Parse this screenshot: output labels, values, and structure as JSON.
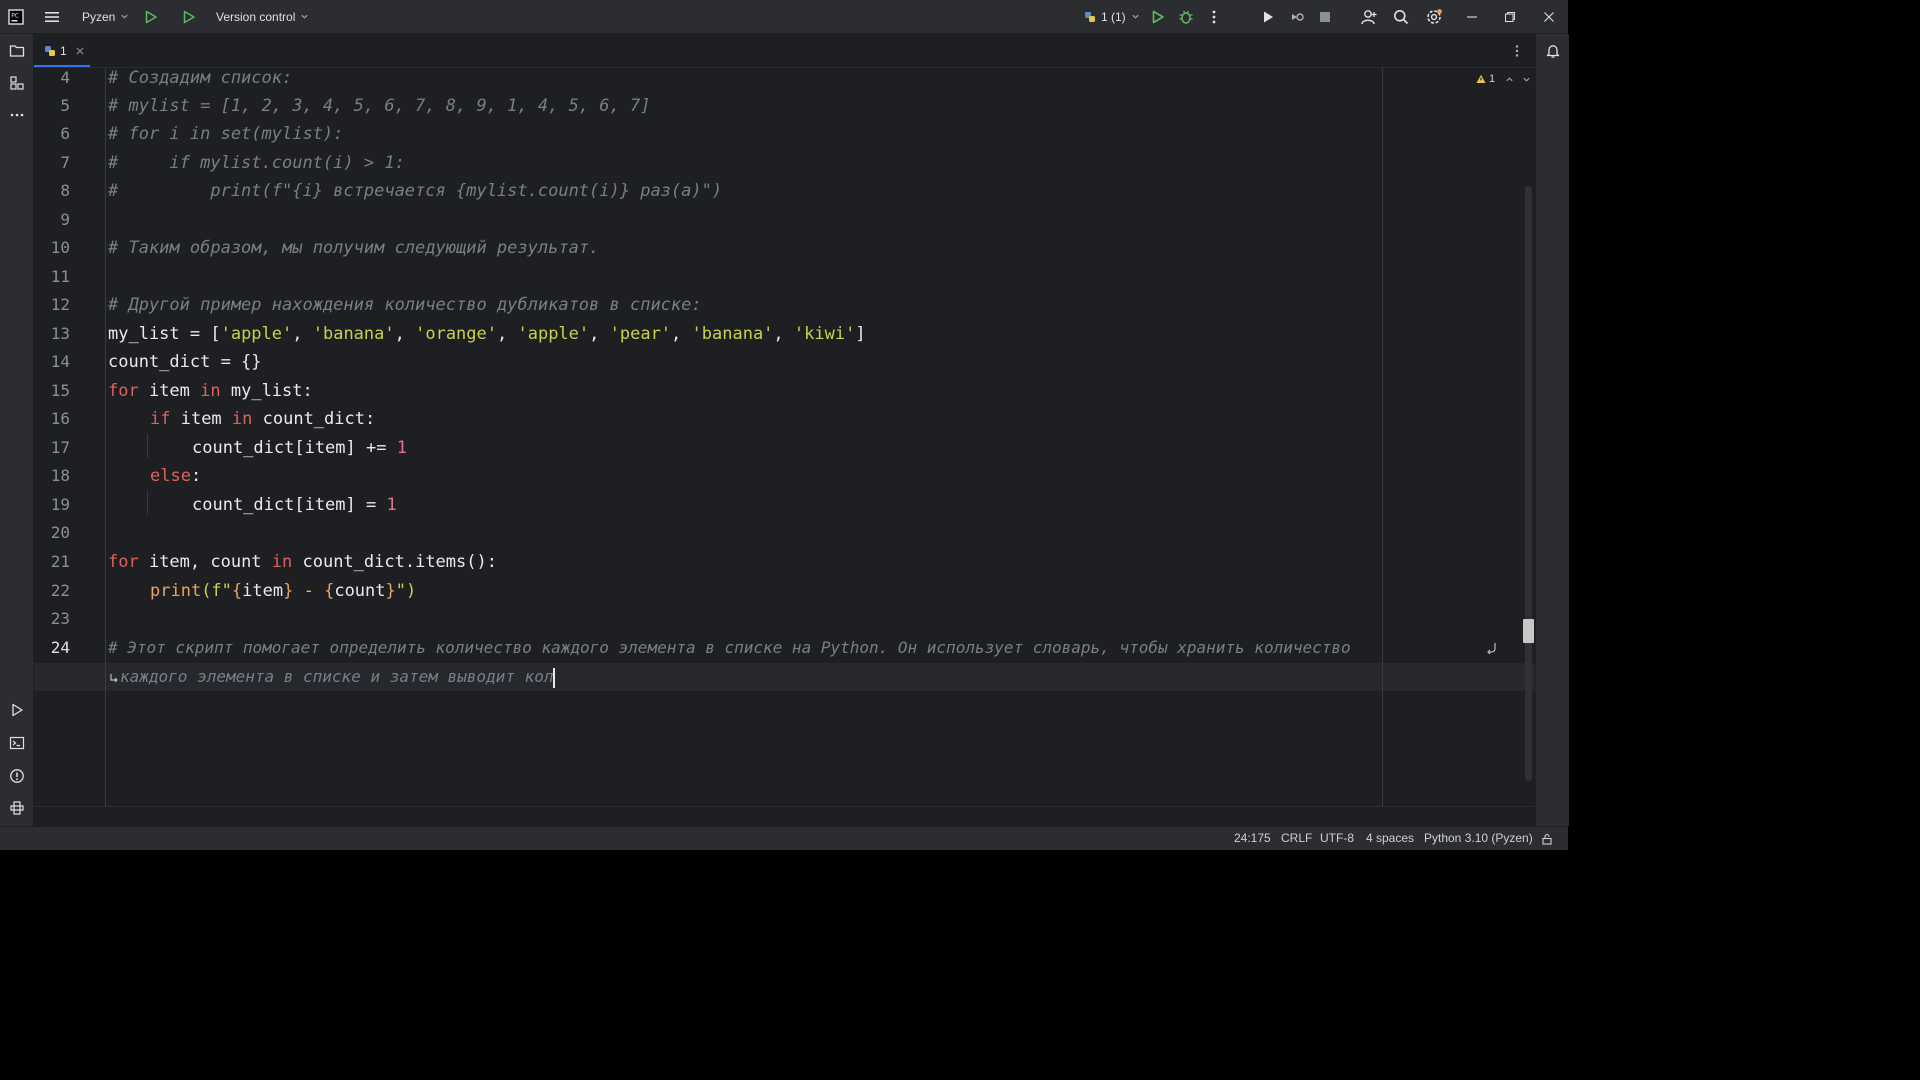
{
  "titlebar": {
    "project": "Pyzen",
    "vcs": "Version control",
    "run_config": "1 (1)"
  },
  "tabs": [
    {
      "label": "1"
    }
  ],
  "inspection": {
    "warnings": "1"
  },
  "editor": {
    "line_numbers": [
      "4",
      "5",
      "6",
      "7",
      "8",
      "9",
      "10",
      "11",
      "12",
      "13",
      "14",
      "15",
      "16",
      "17",
      "18",
      "19",
      "20",
      "21",
      "22",
      "23",
      "24"
    ],
    "lines": {
      "l4": "# Создадим список:",
      "l5": "# mylist = [1, 2, 3, 4, 5, 6, 7, 8, 9, 1, 4, 5, 6, 7]",
      "l6": "# for i in set(mylist):",
      "l7": "#     if mylist.count(i) > 1:",
      "l8": "#         print(f\"{i} встречается {mylist.count(i)} раз(а)\")",
      "l10": "# Таким образом, мы получим следующий результат.",
      "l12": "# Другой пример нахождения количество дубликатов в списке:",
      "l13": {
        "a": "my_list = [",
        "s1": "'apple'",
        "c1": ", ",
        "s2": "'banana'",
        "c2": ", ",
        "s3": "'orange'",
        "c3": ", ",
        "s4": "'apple'",
        "c4": ", ",
        "s5": "'pear'",
        "c5": ", ",
        "s6": "'banana'",
        "c6": ", ",
        "s7": "'kiwi'",
        "z": "]"
      },
      "l14": "count_dict = {}",
      "l15": {
        "kw1": "for",
        "a": " item ",
        "kw2": "in",
        "b": " my_list:"
      },
      "l16": {
        "kw1": "if",
        "a": " item ",
        "kw2": "in",
        "b": " count_dict:"
      },
      "l17": {
        "a": "count_dict[item] += ",
        "n": "1"
      },
      "l18": {
        "kw": "else",
        "b": ":"
      },
      "l19": {
        "a": "count_dict[item] = ",
        "n": "1"
      },
      "l21": {
        "kw1": "for",
        "a": " item, count ",
        "kw2": "in",
        "b": " count_dict.items():"
      },
      "l22": {
        "fn": "print",
        "a": "(f\"",
        "b": "{",
        "c": "item",
        "d": "}",
        "e": " - ",
        "f": "{",
        "g": "count",
        "h": "}",
        "i": "\")"
      },
      "l24": "# Этот скрипт помогает определить количество каждого элемента в списке на Python. Он использует словарь, чтобы хранить количество",
      "l24b": "каждого элемента в списке и затем выводит кол"
    }
  },
  "statusbar": {
    "position": "24:175",
    "line_ending": "CRLF",
    "encoding": "UTF-8",
    "indent": "4 spaces",
    "interpreter": "Python 3.10 (Pyzen)"
  },
  "colors": {
    "keyword": "#e0605c",
    "string": "#c8d24a",
    "number": "#ef6d8c",
    "comment": "#7a7e85",
    "function": "#e8a45a",
    "accent": "#3574f0"
  }
}
